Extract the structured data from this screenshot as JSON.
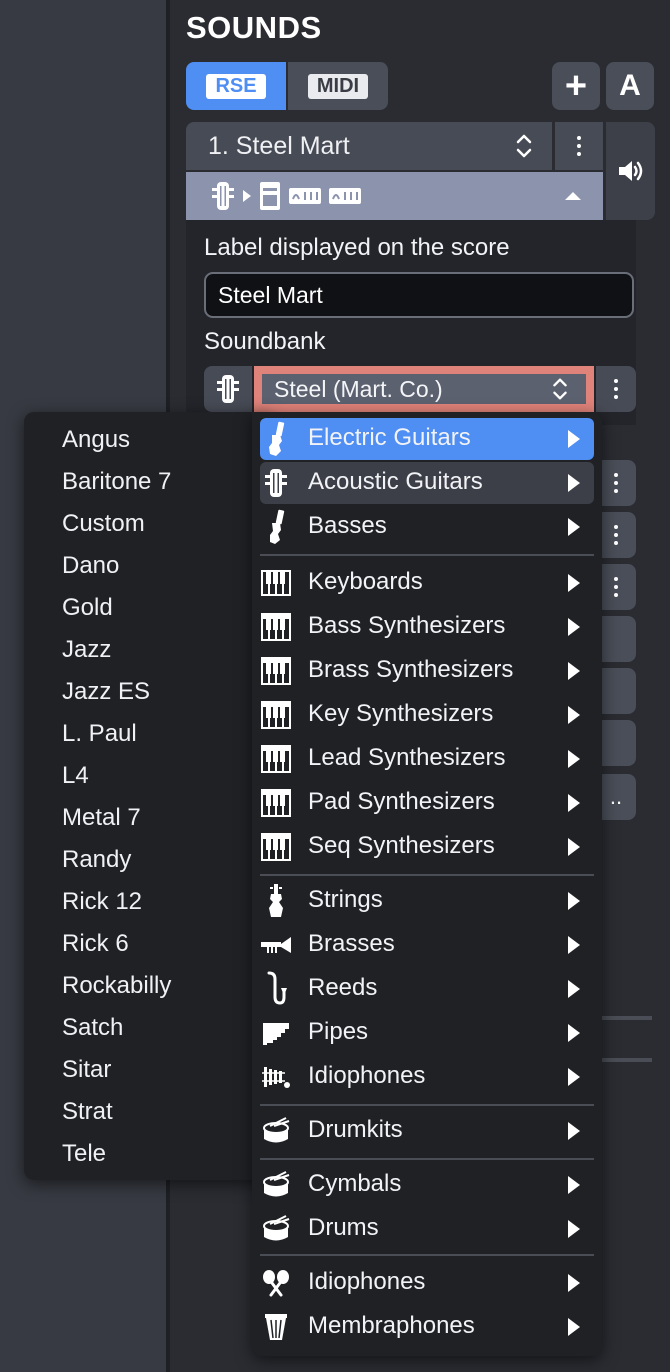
{
  "panel": {
    "title": "SOUNDS",
    "modes": [
      {
        "label": "RSE",
        "active": true
      },
      {
        "label": "MIDI",
        "active": false
      }
    ],
    "add_label": "+",
    "auto_label": "A"
  },
  "track": {
    "name": "1. Steel Mart",
    "label_title": "Label displayed on the score",
    "label_value": "Steel Mart",
    "soundbank_title": "Soundbank",
    "soundbank_value": "Steel (Mart.  Co.)"
  },
  "submenu": {
    "items": [
      "Angus",
      "Baritone 7",
      "Custom",
      "Dano",
      "Gold",
      "Jazz",
      "Jazz ES",
      "L. Paul",
      "L4",
      "Metal 7",
      "Randy",
      "Rick 12",
      "Rick 6",
      "Rockabilly",
      "Satch",
      "Sitar",
      "Strat",
      "Tele"
    ]
  },
  "menu": {
    "items": [
      {
        "label": "Electric Guitars",
        "icon": "electric-guitar-icon",
        "state": "highlighted"
      },
      {
        "label": "Acoustic Guitars",
        "icon": "acoustic-guitar-icon",
        "state": "selected"
      },
      {
        "label": "Basses",
        "icon": "bass-guitar-icon"
      },
      {
        "label": "Keyboards",
        "icon": "keyboard-icon"
      },
      {
        "label": "Bass Synthesizers",
        "icon": "synthesizer-icon"
      },
      {
        "label": "Brass Synthesizers",
        "icon": "synthesizer-icon"
      },
      {
        "label": "Key Synthesizers",
        "icon": "synthesizer-icon"
      },
      {
        "label": "Lead Synthesizers",
        "icon": "synthesizer-icon"
      },
      {
        "label": "Pad Synthesizers",
        "icon": "synthesizer-icon"
      },
      {
        "label": "Seq Synthesizers",
        "icon": "synthesizer-icon"
      },
      {
        "label": "Strings",
        "icon": "strings-icon"
      },
      {
        "label": "Brasses",
        "icon": "trumpet-icon"
      },
      {
        "label": "Reeds",
        "icon": "saxophone-icon"
      },
      {
        "label": "Pipes",
        "icon": "pan-pipes-icon"
      },
      {
        "label": "Idiophones",
        "icon": "xylophone-icon"
      },
      {
        "label": "Drumkits",
        "icon": "drum-icon"
      },
      {
        "label": "Cymbals",
        "icon": "drum-icon"
      },
      {
        "label": "Drums",
        "icon": "drum-icon"
      },
      {
        "label": "Idiophones",
        "icon": "maracas-icon"
      },
      {
        "label": "Membraphones",
        "icon": "hand-drum-icon"
      }
    ]
  },
  "background": {
    "partial_text": ".."
  },
  "colors": {
    "accent": "#4f8ef2",
    "panel_bg": "#2a2c32",
    "menu_bg": "#1f2125",
    "selection_outline": "#e0837a",
    "chain_bar": "#8b93ad"
  }
}
